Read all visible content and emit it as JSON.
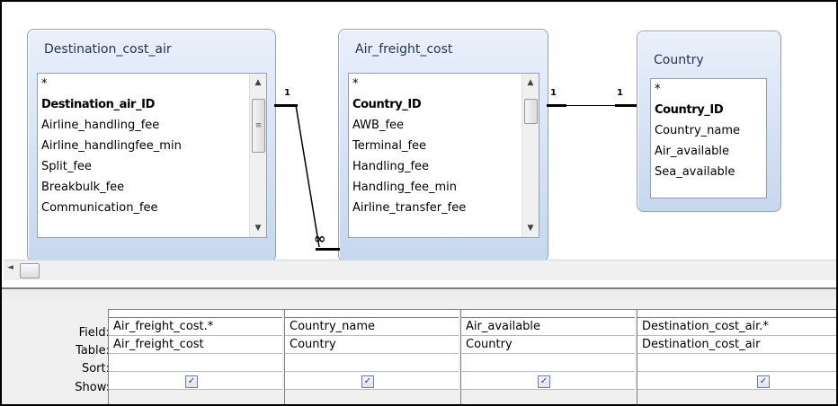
{
  "tables": [
    {
      "title": "Destination_cost_air",
      "fields": [
        {
          "label": "*",
          "key": false
        },
        {
          "label": "Destination_air_ID",
          "key": true
        },
        {
          "label": "Airline_handling_fee",
          "key": false
        },
        {
          "label": "Airline_handlingfee_min",
          "key": false
        },
        {
          "label": "Split_fee",
          "key": false
        },
        {
          "label": "Breakbulk_fee",
          "key": false
        },
        {
          "label": "Communication_fee",
          "key": false
        }
      ]
    },
    {
      "title": "Air_freight_cost",
      "fields": [
        {
          "label": "*",
          "key": false
        },
        {
          "label": "Country_ID",
          "key": true
        },
        {
          "label": "AWB_fee",
          "key": false
        },
        {
          "label": "Terminal_fee",
          "key": false
        },
        {
          "label": "Handling_fee",
          "key": false
        },
        {
          "label": "Handling_fee_min",
          "key": false
        },
        {
          "label": "Airline_transfer_fee",
          "key": false
        }
      ]
    },
    {
      "title": "Country",
      "fields": [
        {
          "label": "*",
          "key": false
        },
        {
          "label": "Country_ID",
          "key": true
        },
        {
          "label": "Country_name",
          "key": false
        },
        {
          "label": "Air_available",
          "key": false
        },
        {
          "label": "Sea_available",
          "key": false
        }
      ]
    }
  ],
  "relationships": [
    {
      "from": "Destination_cost_air",
      "to": "Air_freight_cost",
      "from_card": "1",
      "to_card": "∞"
    },
    {
      "from": "Air_freight_cost",
      "to": "Country",
      "from_card": "1",
      "to_card": "1"
    }
  ],
  "grid": {
    "row_labels": [
      "Field:",
      "Table:",
      "Sort:",
      "Show:"
    ],
    "columns": [
      {
        "field": "Air_freight_cost.*",
        "table": "Air_freight_cost",
        "sort": "",
        "show": true
      },
      {
        "field": "Country_name",
        "table": "Country",
        "sort": "",
        "show": true
      },
      {
        "field": "Air_available",
        "table": "Country",
        "sort": "",
        "show": true
      },
      {
        "field": "Destination_cost_air.*",
        "table": "Destination_cost_air",
        "sort": "",
        "show": true
      }
    ]
  },
  "icons": {
    "scroll_up": "▲",
    "scroll_down": "▼",
    "scroll_left": "◄",
    "thumb_grip": "≡",
    "check": "✓"
  }
}
